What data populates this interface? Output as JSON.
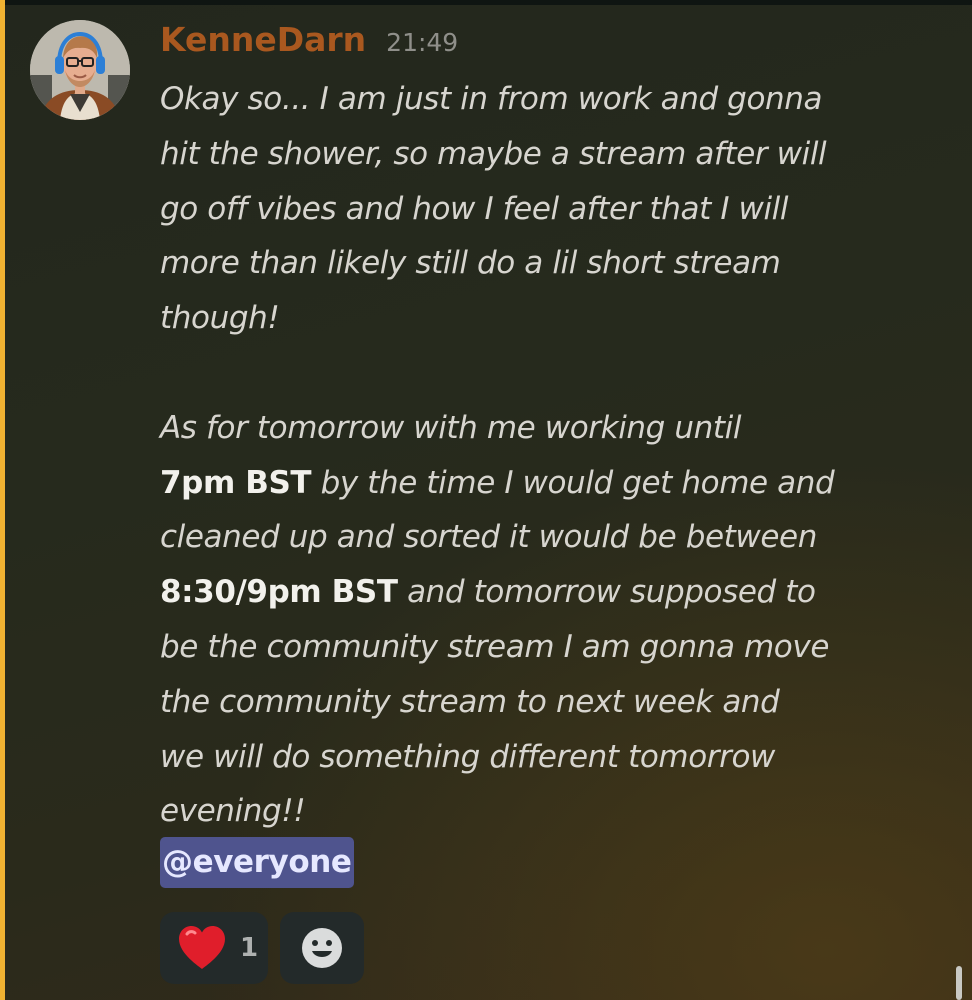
{
  "message": {
    "author": "KenneDarn",
    "timestamp": "21:49",
    "lines": [
      "Okay so... I am just in from work and gonna",
      "hit the shower, so maybe a stream after will",
      "go off vibes and how I feel after that I will",
      "more than likely still do a lil short stream",
      "though!",
      "As for tomorrow with me working until",
      "7pm BST",
      "by the time I would get home and",
      "cleaned up and sorted it would be between",
      "8:30/9pm BST",
      "and tomorrow supposed to",
      "be the community stream I am gonna move",
      "the community stream to next week and",
      "we will do something different tomorrow",
      "evening!!"
    ],
    "mention": "@everyone"
  },
  "reactions": [
    {
      "emoji": "❤️",
      "icon": "red-heart-emoji",
      "count": "1"
    },
    {
      "icon": "add-reaction-smiley-icon"
    }
  ],
  "colors": {
    "username": "#a9581f",
    "mention_highlight_bar": "#f0b232",
    "mention_background": "#4f548e",
    "reaction_background": "#232a2a"
  }
}
